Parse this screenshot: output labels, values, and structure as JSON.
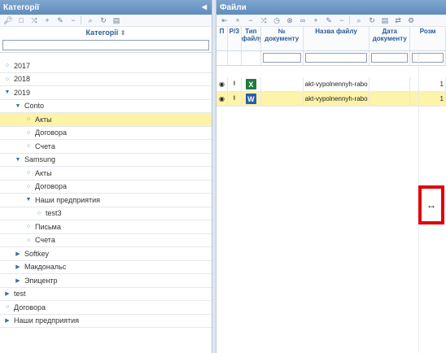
{
  "left_panel": {
    "title": "Категорії",
    "column_title": "Категорії",
    "filter_value": "",
    "tree": [
      {
        "label": "2017",
        "level": 0,
        "type": "leaf"
      },
      {
        "label": "2018",
        "level": 0,
        "type": "leaf"
      },
      {
        "label": "2019",
        "level": 0,
        "type": "expanded"
      },
      {
        "label": "Conto",
        "level": 1,
        "type": "expanded"
      },
      {
        "label": "Акты",
        "level": 2,
        "type": "leaf",
        "selected": true
      },
      {
        "label": "Договора",
        "level": 2,
        "type": "leaf"
      },
      {
        "label": "Счета",
        "level": 2,
        "type": "leaf"
      },
      {
        "label": "Samsung",
        "level": 1,
        "type": "expanded"
      },
      {
        "label": "Акты",
        "level": 2,
        "type": "leaf"
      },
      {
        "label": "Договора",
        "level": 2,
        "type": "leaf"
      },
      {
        "label": "Наши предприятия",
        "level": 2,
        "type": "expanded"
      },
      {
        "label": "test3",
        "level": 3,
        "type": "leaf"
      },
      {
        "label": "Письма",
        "level": 2,
        "type": "leaf"
      },
      {
        "label": "Счета",
        "level": 2,
        "type": "leaf"
      },
      {
        "label": "Softkey",
        "level": 1,
        "type": "collapsed"
      },
      {
        "label": "Макдональс",
        "level": 1,
        "type": "collapsed"
      },
      {
        "label": "Эпицентр",
        "level": 1,
        "type": "collapsed"
      },
      {
        "label": "test",
        "level": 0,
        "type": "collapsed"
      },
      {
        "label": "Договора",
        "level": 0,
        "type": "leaf"
      },
      {
        "label": "Наши предприятия",
        "level": 0,
        "type": "collapsed"
      }
    ]
  },
  "right_panel": {
    "title": "Файли",
    "columns": [
      "П",
      "Р/З",
      "Тип файлу",
      "№ документу",
      "Назва файлу",
      "Дата документу",
      "Розм"
    ],
    "rows": [
      {
        "file_type": "X",
        "file_color": "#1f7a3f",
        "name": "akt-vypolnennyh-rabo",
        "size": "1"
      },
      {
        "file_type": "W",
        "file_color": "#2a5caa",
        "name": "akt-vypolnennyh-rabo",
        "size": "1",
        "selected": true
      }
    ]
  },
  "resize_cursor": "↔"
}
